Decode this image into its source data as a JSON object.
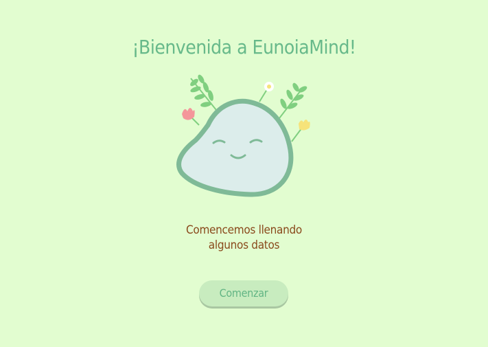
{
  "welcome": {
    "title": "¡Bienvenida a EunoiaMind!",
    "subtitle": "Comencemos llenando\nalgunos datos",
    "start_button_label": "Comenzar",
    "mascot_icon": "smiling-blob-with-flowers-icon"
  },
  "colors": {
    "background": "#e2fdd0",
    "title": "#67b98a",
    "subtitle": "#8a4a1c",
    "button_bg": "#c8ecbf",
    "button_text": "#62b584",
    "mascot_body": "#dcedeb",
    "mascot_outline": "#7fba97",
    "leaf": "#80cf80",
    "pink_flower": "#f4969a",
    "yellow_flower": "#f6e37a"
  }
}
